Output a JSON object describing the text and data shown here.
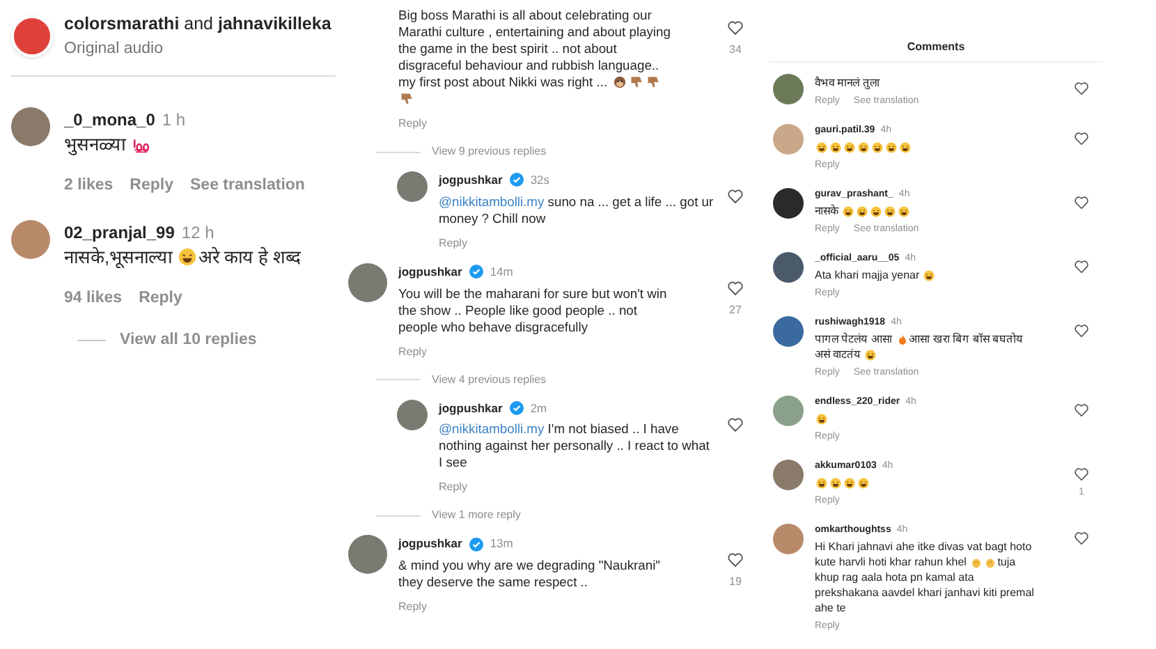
{
  "left": {
    "header": {
      "title": "**colorsmarathi** and **jahnavikilleka**",
      "subtitle": "Original audio"
    },
    "comments": [
      {
        "user": "_0_mona_0",
        "time": "1 h",
        "parts": [
          {
            "kind": "text",
            "text": "भुसनळ्या"
          },
          {
            "kind": "hundred"
          }
        ],
        "likes": "2 likes",
        "reply": "Reply",
        "translation": "See translation"
      },
      {
        "user": "02_pranjal_99",
        "time": "12 h",
        "parts": [
          {
            "kind": "text",
            "text": "नासके,भूसनाल्या"
          },
          {
            "kind": "laugh"
          },
          {
            "kind": "text",
            "text": "अरे काय हे शब्द"
          }
        ],
        "likes": "94 likes",
        "reply": "Reply"
      }
    ],
    "view_replies": "View all 10 replies"
  },
  "middle": {
    "items": [
      {
        "kind": "cut",
        "parts": [
          {
            "kind": "text",
            "text": "Big boss Marathi is all about celebrating our Marathi culture , entertaining and about playing the game in the best spirit .. not about disgraceful behaviour and rubbish language.. my first post about Nikki was right ..."
          },
          {
            "kind": "monkey"
          },
          {
            "kind": "thumbsdown"
          },
          {
            "kind": "thumbsdown"
          },
          {
            "kind": "thumbsdown"
          }
        ],
        "reply": "Reply",
        "count": "34"
      },
      {
        "kind": "more",
        "text": "View 9 previous replies"
      },
      {
        "kind": "reply",
        "user": "jogpushkar",
        "time": "32s",
        "mention": "@nikkitambolli.my",
        "parts": [
          {
            "kind": "text",
            "text": "suno na ... get a life ... got ur money ? Chill now"
          }
        ],
        "reply": "Reply"
      },
      {
        "kind": "comment",
        "user": "jogpushkar",
        "time": "14m",
        "parts": [
          {
            "kind": "text",
            "text": "You will be the maharani for sure but won't win the show .. People like good people .. not people who behave disgracefully"
          }
        ],
        "reply": "Reply",
        "count": "27"
      },
      {
        "kind": "more",
        "text": "View 4 previous replies"
      },
      {
        "kind": "reply",
        "user": "jogpushkar",
        "time": "2m",
        "mention": "@nikkitambolli.my",
        "parts": [
          {
            "kind": "text",
            "text": "I'm not biased .. I have nothing against her personally .. I react to what I see"
          }
        ],
        "reply": "Reply"
      },
      {
        "kind": "more",
        "text": "View 1 more reply"
      },
      {
        "kind": "comment",
        "user": "jogpushkar",
        "time": "13m",
        "parts": [
          {
            "kind": "text",
            "text": "& mind you why are we degrading \"Naukrani\" they deserve the same  respect .."
          }
        ],
        "reply": "Reply",
        "count": "19"
      }
    ]
  },
  "right": {
    "title": "Comments",
    "comments": [
      {
        "parts": [
          {
            "kind": "text",
            "text": "वैभव मानलं तुला"
          }
        ],
        "reply": "Reply",
        "translation": "See translation"
      },
      {
        "user": "gauri.patil.39",
        "time": "4h",
        "parts": [
          {
            "kind": "laugh"
          },
          {
            "kind": "laugh"
          },
          {
            "kind": "laugh"
          },
          {
            "kind": "laugh"
          },
          {
            "kind": "laugh"
          },
          {
            "kind": "laugh"
          },
          {
            "kind": "laugh"
          }
        ],
        "reply": "Reply"
      },
      {
        "user": "gurav_prashant_",
        "time": "4h",
        "parts": [
          {
            "kind": "text",
            "text": "नासके"
          },
          {
            "kind": "laugh"
          },
          {
            "kind": "laugh"
          },
          {
            "kind": "laugh"
          },
          {
            "kind": "laugh"
          },
          {
            "kind": "laugh"
          }
        ],
        "reply": "Reply",
        "translation": "See translation"
      },
      {
        "user": "_official_aaru__05",
        "time": "4h",
        "parts": [
          {
            "kind": "text",
            "text": "Ata khari majja yenar"
          },
          {
            "kind": "laugh"
          }
        ],
        "reply": "Reply"
      },
      {
        "user": "rushiwagh1918",
        "time": "4h",
        "parts": [
          {
            "kind": "text",
            "text": "पागल पेटलंय आसा"
          },
          {
            "kind": "fire"
          },
          {
            "kind": "text",
            "text": "आसा खरा बिग बॉस बघतोय असं वाटतंय"
          },
          {
            "kind": "laugh"
          }
        ],
        "reply": "Reply",
        "translation": "See translation"
      },
      {
        "user": "endless_220_rider",
        "time": "4h",
        "parts": [
          {
            "kind": "laugh"
          }
        ],
        "reply": "Reply"
      },
      {
        "user": "akkumar0103",
        "time": "4h",
        "parts": [
          {
            "kind": "laugh"
          },
          {
            "kind": "laugh"
          },
          {
            "kind": "laugh"
          },
          {
            "kind": "laugh"
          }
        ],
        "reply": "Reply",
        "count": "1"
      },
      {
        "user": "omkarthoughtss",
        "time": "4h",
        "parts": [
          {
            "kind": "text",
            "text": "Hi Khari jahnavi ahe itke divas vat bagt hoto kute harvli hoti khar rahun khel"
          },
          {
            "kind": "clap"
          },
          {
            "kind": "clap"
          },
          {
            "kind": "text",
            "text": "tuja khup rag aala hota pn kamal ata prekshakana aavdel khari janhavi kiti premal ahe te"
          }
        ],
        "reply": "Reply"
      }
    ]
  }
}
